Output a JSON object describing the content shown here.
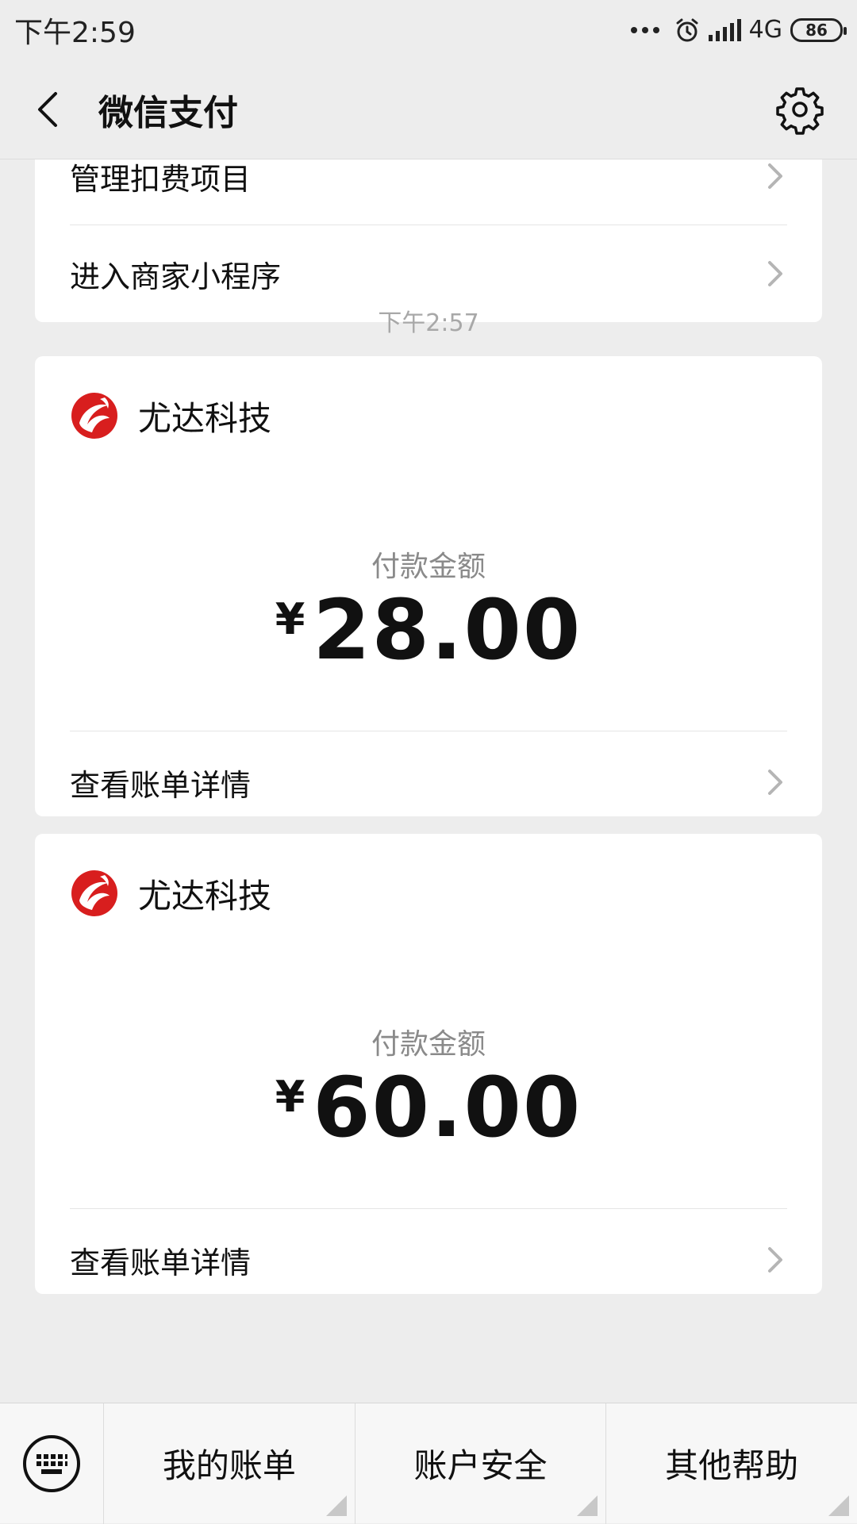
{
  "status_bar": {
    "time": "下午2:59",
    "network": "4G",
    "battery": "86"
  },
  "header": {
    "title": "微信支付"
  },
  "top_card": {
    "items": [
      {
        "label": "管理扣费项目"
      },
      {
        "label": "进入商家小程序"
      }
    ]
  },
  "message_time": "下午2:57",
  "payments": [
    {
      "merchant": "尤达科技",
      "amount_label": "付款金额",
      "currency": "¥",
      "amount": "28.00",
      "detail_label": "查看账单详情"
    },
    {
      "merchant": "尤达科技",
      "amount_label": "付款金额",
      "currency": "¥",
      "amount": "60.00",
      "detail_label": "查看账单详情"
    }
  ],
  "bottom_menu": {
    "items": [
      {
        "label": "我的账单"
      },
      {
        "label": "账户安全"
      },
      {
        "label": "其他帮助"
      }
    ]
  },
  "colors": {
    "background": "#ededed",
    "card": "#ffffff",
    "logo_red": "#d81e1e"
  }
}
